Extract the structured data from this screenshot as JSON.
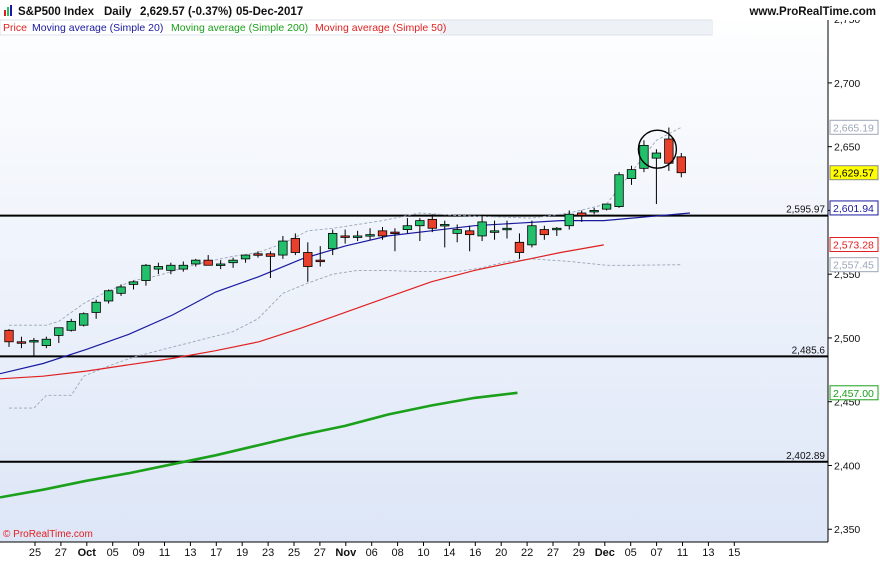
{
  "header": {
    "instrument": "S&P500 Index",
    "period": "Daily",
    "quote": "2,629.57 (-0.37%)",
    "date": "05-Dec-2017",
    "website": "www.ProRealTime.com"
  },
  "legend": [
    {
      "label": "Price",
      "color": "#e02020"
    },
    {
      "label": "Moving average (Simple 20)",
      "color": "#1a1aa0"
    },
    {
      "label": "Moving average (Simple 200)",
      "color": "#1aa01a"
    },
    {
      "label": "Moving average (Simple 50)",
      "color": "#e02020"
    }
  ],
  "watermark": "© ProRealTime.com",
  "colors": {
    "background_top": "#ffffff",
    "background_bottom": "#dde6f7",
    "up_candle": "#22c06a",
    "down_candle": "#e8402a",
    "ma20": "#1a1aa0",
    "ma50": "#e02020",
    "ma200": "#1aa01a",
    "bollinger": "#9aa6b8"
  },
  "chart_data": {
    "type": "candlestick",
    "title": "S&P500 Index",
    "ylim": [
      2340,
      2765
    ],
    "y_ticks": [
      "2,750",
      "2,700",
      "2,650",
      "2,600",
      "2,550",
      "2,500",
      "2,450",
      "2,400",
      "2,350"
    ],
    "y_tick_values": [
      2750,
      2700,
      2650,
      2600,
      2550,
      2500,
      2450,
      2400,
      2350
    ],
    "x_ticks": [
      "25",
      "27",
      "Oct",
      "05",
      "09",
      "11",
      "13",
      "17",
      "19",
      "23",
      "25",
      "27",
      "Nov",
      "06",
      "08",
      "10",
      "14",
      "16",
      "20",
      "22",
      "27",
      "29",
      "Dec",
      "05",
      "07",
      "11",
      "13",
      "15"
    ],
    "x_tick_bold": [
      "Oct",
      "Nov",
      "Dec"
    ],
    "candles": [
      {
        "d": "Sep 25",
        "o": 2506,
        "h": 2507,
        "l": 2493,
        "c": 2497
      },
      {
        "d": "Sep 26",
        "o": 2497,
        "h": 2501,
        "l": 2492,
        "c": 2496
      },
      {
        "d": "Sep 27",
        "o": 2497,
        "h": 2500,
        "l": 2486,
        "c": 2498
      },
      {
        "d": "Sep 28",
        "o": 2494,
        "h": 2501,
        "l": 2492,
        "c": 2499
      },
      {
        "d": "Sep 29",
        "o": 2502,
        "h": 2508,
        "l": 2496,
        "c": 2508
      },
      {
        "d": "Oct 02",
        "o": 2506,
        "h": 2515,
        "l": 2505,
        "c": 2513
      },
      {
        "d": "Oct 03",
        "o": 2510,
        "h": 2520,
        "l": 2509,
        "c": 2519
      },
      {
        "d": "Oct 04",
        "o": 2520,
        "h": 2530,
        "l": 2515,
        "c": 2528
      },
      {
        "d": "Oct 05",
        "o": 2529,
        "h": 2538,
        "l": 2527,
        "c": 2537
      },
      {
        "d": "Oct 06",
        "o": 2535,
        "h": 2542,
        "l": 2533,
        "c": 2540
      },
      {
        "d": "Oct 09",
        "o": 2542,
        "h": 2545,
        "l": 2538,
        "c": 2544
      },
      {
        "d": "Oct 10",
        "o": 2545,
        "h": 2558,
        "l": 2541,
        "c": 2557
      },
      {
        "d": "Oct 11",
        "o": 2554,
        "h": 2559,
        "l": 2550,
        "c": 2556
      },
      {
        "d": "Oct 12",
        "o": 2553,
        "h": 2559,
        "l": 2550,
        "c": 2557
      },
      {
        "d": "Oct 13",
        "o": 2554,
        "h": 2560,
        "l": 2552,
        "c": 2557
      },
      {
        "d": "Oct 16",
        "o": 2558,
        "h": 2562,
        "l": 2556,
        "c": 2561
      },
      {
        "d": "Oct 17",
        "o": 2561,
        "h": 2565,
        "l": 2557,
        "c": 2557
      },
      {
        "d": "Oct 18",
        "o": 2558,
        "h": 2561,
        "l": 2554,
        "c": 2558
      },
      {
        "d": "Oct 19",
        "o": 2559,
        "h": 2563,
        "l": 2555,
        "c": 2561
      },
      {
        "d": "Oct 20",
        "o": 2562,
        "h": 2565,
        "l": 2559,
        "c": 2565
      },
      {
        "d": "Oct 23",
        "o": 2566,
        "h": 2568,
        "l": 2563,
        "c": 2565
      },
      {
        "d": "Oct 24",
        "o": 2566,
        "h": 2568,
        "l": 2547,
        "c": 2564
      },
      {
        "d": "Oct 25",
        "o": 2565,
        "h": 2580,
        "l": 2562,
        "c": 2576
      },
      {
        "d": "Oct 26",
        "o": 2578,
        "h": 2582,
        "l": 2565,
        "c": 2567
      },
      {
        "d": "Oct 27",
        "o": 2567,
        "h": 2575,
        "l": 2544,
        "c": 2556
      },
      {
        "d": "Oct 30",
        "o": 2561,
        "h": 2572,
        "l": 2556,
        "c": 2560
      },
      {
        "d": "Oct 31",
        "o": 2570,
        "h": 2585,
        "l": 2565,
        "c": 2582
      },
      {
        "d": "Nov 01",
        "o": 2580,
        "h": 2585,
        "l": 2574,
        "c": 2579
      },
      {
        "d": "Nov 02",
        "o": 2579,
        "h": 2584,
        "l": 2576,
        "c": 2580
      },
      {
        "d": "Nov 03",
        "o": 2580,
        "h": 2586,
        "l": 2577,
        "c": 2581
      },
      {
        "d": "Nov 06",
        "o": 2584,
        "h": 2587,
        "l": 2577,
        "c": 2580
      },
      {
        "d": "Nov 07",
        "o": 2583,
        "h": 2586,
        "l": 2568,
        "c": 2582
      },
      {
        "d": "Nov 08",
        "o": 2585,
        "h": 2594,
        "l": 2582,
        "c": 2588
      },
      {
        "d": "Nov 09",
        "o": 2588,
        "h": 2594,
        "l": 2576,
        "c": 2592
      },
      {
        "d": "Nov 10",
        "o": 2593,
        "h": 2597,
        "l": 2583,
        "c": 2586
      },
      {
        "d": "Nov 13",
        "o": 2589,
        "h": 2592,
        "l": 2571,
        "c": 2589
      },
      {
        "d": "Nov 14",
        "o": 2582,
        "h": 2589,
        "l": 2575,
        "c": 2585
      },
      {
        "d": "Nov 15",
        "o": 2584,
        "h": 2588,
        "l": 2568,
        "c": 2581
      },
      {
        "d": "Nov 16",
        "o": 2580,
        "h": 2595,
        "l": 2576,
        "c": 2591
      },
      {
        "d": "Nov 17",
        "o": 2584,
        "h": 2592,
        "l": 2577,
        "c": 2584
      },
      {
        "d": "Nov 20",
        "o": 2585,
        "h": 2592,
        "l": 2578,
        "c": 2586
      },
      {
        "d": "Nov 21",
        "o": 2575,
        "h": 2582,
        "l": 2562,
        "c": 2567
      },
      {
        "d": "Nov 22",
        "o": 2573,
        "h": 2592,
        "l": 2571,
        "c": 2588
      },
      {
        "d": "Nov 24",
        "o": 2585,
        "h": 2588,
        "l": 2577,
        "c": 2581
      },
      {
        "d": "Nov 27",
        "o": 2585,
        "h": 2587,
        "l": 2580,
        "c": 2586
      },
      {
        "d": "Nov 28",
        "o": 2588,
        "h": 2600,
        "l": 2585,
        "c": 2597
      },
      {
        "d": "Nov 29",
        "o": 2598,
        "h": 2600,
        "l": 2591,
        "c": 2596
      },
      {
        "d": "Nov 30",
        "o": 2600,
        "h": 2602,
        "l": 2597,
        "c": 2600
      },
      {
        "d": "Dec 01",
        "o": 2601,
        "h": 2605,
        "l": 2600,
        "c": 2605
      },
      {
        "d": "Dec 04",
        "o": 2603,
        "h": 2630,
        "l": 2602,
        "c": 2628
      },
      {
        "d": "Dec 05",
        "o": 2625,
        "h": 2635,
        "l": 2620,
        "c": 2632
      },
      {
        "d": "Dec 06",
        "o": 2633,
        "h": 2655,
        "l": 2630,
        "c": 2651
      },
      {
        "d": "Dec 07",
        "o": 2641,
        "h": 2648,
        "l": 2605,
        "c": 2645
      },
      {
        "d": "Dec 08",
        "o": 2656,
        "h": 2665,
        "l": 2631,
        "c": 2637
      },
      {
        "d": "Dec 09",
        "o": 2642,
        "h": 2645,
        "l": 2626,
        "c": 2629.57
      }
    ],
    "series": [
      {
        "name": "Moving average (Simple 20)",
        "values": [
          [
            0,
            2472
          ],
          [
            5,
            2480
          ],
          [
            10,
            2491
          ],
          [
            15,
            2503
          ],
          [
            20,
            2518
          ],
          [
            25,
            2536
          ],
          [
            30,
            2548
          ],
          [
            35,
            2562
          ],
          [
            40,
            2572
          ],
          [
            45,
            2580
          ],
          [
            50,
            2584
          ],
          [
            55,
            2588
          ],
          [
            60,
            2590
          ],
          [
            65,
            2592
          ],
          [
            70,
            2592
          ],
          [
            75,
            2595
          ],
          [
            80,
            2598
          ]
        ]
      },
      {
        "name": "Moving average (Simple 50)",
        "values": [
          [
            0,
            2468
          ],
          [
            5,
            2470
          ],
          [
            10,
            2474
          ],
          [
            15,
            2479
          ],
          [
            20,
            2484
          ],
          [
            25,
            2490
          ],
          [
            30,
            2497
          ],
          [
            35,
            2508
          ],
          [
            40,
            2520
          ],
          [
            45,
            2532
          ],
          [
            50,
            2544
          ],
          [
            55,
            2553
          ],
          [
            60,
            2560
          ],
          [
            65,
            2567
          ],
          [
            70,
            2573
          ]
        ]
      },
      {
        "name": "Moving average (Simple 200)",
        "values": [
          [
            0,
            2375
          ],
          [
            5,
            2381
          ],
          [
            10,
            2388
          ],
          [
            15,
            2394
          ],
          [
            20,
            2401
          ],
          [
            25,
            2408
          ],
          [
            30,
            2416
          ],
          [
            35,
            2424
          ],
          [
            40,
            2431
          ],
          [
            45,
            2440
          ],
          [
            50,
            2447
          ],
          [
            55,
            2453
          ],
          [
            60,
            2457
          ]
        ]
      }
    ],
    "horizontal_lines": [
      {
        "value": 2595.97,
        "label": "2,595.97"
      },
      {
        "value": 2485.6,
        "label": "2,485.6"
      },
      {
        "value": 2402.89,
        "label": "2,402.89"
      }
    ],
    "price_labels": [
      {
        "value": 2665.19,
        "label": "2,665.19",
        "kind": "bollinger"
      },
      {
        "value": 2629.57,
        "label": "2,629.57",
        "kind": "price"
      },
      {
        "value": 2601.94,
        "label": "2,601.94",
        "kind": "ma20"
      },
      {
        "value": 2573.28,
        "label": "2,573.28",
        "kind": "ma50"
      },
      {
        "value": 2557.45,
        "label": "2,557.45",
        "kind": "bollinger"
      },
      {
        "value": 2457.0,
        "label": "2,457.00",
        "kind": "ma200"
      }
    ],
    "bollinger_upper": [
      [
        0,
        2510
      ],
      [
        3,
        2510
      ],
      [
        4,
        2513
      ],
      [
        5,
        2520
      ],
      [
        6,
        2527
      ],
      [
        8,
        2537
      ],
      [
        10,
        2545
      ],
      [
        12,
        2549
      ],
      [
        14,
        2555
      ],
      [
        16,
        2560
      ],
      [
        18,
        2564
      ],
      [
        20,
        2567
      ],
      [
        22,
        2574
      ],
      [
        24,
        2584
      ],
      [
        26,
        2586
      ],
      [
        28,
        2589
      ],
      [
        30,
        2592
      ],
      [
        32,
        2596
      ],
      [
        33,
        2598
      ],
      [
        36,
        2596
      ],
      [
        39,
        2595
      ],
      [
        42,
        2594
      ],
      [
        45,
        2598
      ],
      [
        48,
        2605
      ],
      [
        50,
        2630
      ],
      [
        52,
        2655
      ],
      [
        54,
        2665.19
      ]
    ],
    "bollinger_lower": [
      [
        0,
        2445
      ],
      [
        2,
        2445
      ],
      [
        3,
        2455
      ],
      [
        5,
        2455
      ],
      [
        6,
        2470
      ],
      [
        8,
        2478
      ],
      [
        10,
        2485
      ],
      [
        12,
        2490
      ],
      [
        14,
        2495
      ],
      [
        16,
        2500
      ],
      [
        18,
        2505
      ],
      [
        20,
        2515
      ],
      [
        21,
        2525
      ],
      [
        22,
        2535
      ],
      [
        24,
        2543
      ],
      [
        26,
        2550
      ],
      [
        28,
        2553
      ],
      [
        30,
        2553
      ],
      [
        33,
        2552
      ],
      [
        36,
        2552
      ],
      [
        38,
        2555
      ],
      [
        40,
        2560
      ],
      [
        42,
        2562
      ],
      [
        45,
        2560
      ],
      [
        48,
        2557
      ],
      [
        50,
        2557
      ],
      [
        54,
        2557.45
      ]
    ],
    "annotation": {
      "type": "circle",
      "candle_index": 52,
      "value": 2648
    }
  }
}
